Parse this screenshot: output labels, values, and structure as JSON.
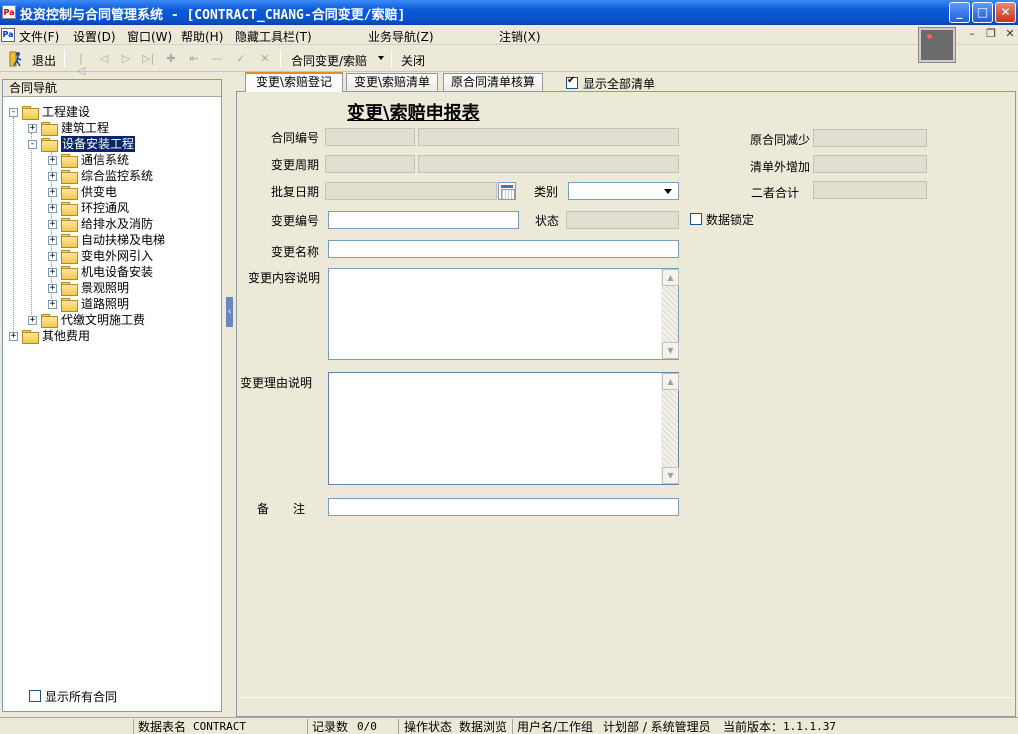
{
  "window": {
    "title": "投资控制与合同管理系统 - [CONTRACT_CHANG-合同变更/索赔]",
    "app_icon": "app-icon",
    "controls": {
      "minimize": "_",
      "maximize": "□",
      "close": "✕"
    }
  },
  "menubar": {
    "items": [
      "文件(F)",
      "设置(D)",
      "窗口(W)",
      "帮助(H)",
      "隐藏工具栏(T)",
      "业务导航(Z)",
      "注销(X)"
    ],
    "mdi_controls": [
      "–",
      "❐",
      "✕"
    ]
  },
  "toolbar": {
    "exit_label": "退出",
    "module_dropdown": "合同变更/索赔",
    "close_label": "关闭"
  },
  "nav": {
    "header": "合同导航",
    "tree": [
      {
        "label": "工程建设",
        "expander": "−",
        "level": 0
      },
      {
        "label": "建筑工程",
        "expander": "+",
        "level": 1
      },
      {
        "label": "设备安装工程",
        "expander": "−",
        "level": 1,
        "selected": true
      },
      {
        "label": "通信系统",
        "expander": "+",
        "level": 2
      },
      {
        "label": "综合监控系统",
        "expander": "+",
        "level": 2
      },
      {
        "label": "供变电",
        "expander": "+",
        "level": 2
      },
      {
        "label": "环控通风",
        "expander": "+",
        "level": 2
      },
      {
        "label": "给排水及消防",
        "expander": "+",
        "level": 2
      },
      {
        "label": "自动扶梯及电梯",
        "expander": "+",
        "level": 2
      },
      {
        "label": "变电外网引入",
        "expander": "+",
        "level": 2
      },
      {
        "label": "机电设备安装",
        "expander": "+",
        "level": 2
      },
      {
        "label": "景观照明",
        "expander": "+",
        "level": 2
      },
      {
        "label": "道路照明",
        "expander": "+",
        "level": 2
      },
      {
        "label": "代缴文明施工费",
        "expander": "+",
        "level": 1
      },
      {
        "label": "其他费用",
        "expander": "+",
        "level": 0
      }
    ],
    "show_all_contracts": "显示所有合同"
  },
  "tabs": {
    "items": [
      "变更\\索赔登记",
      "变更\\索赔清单",
      "原合同清单核算"
    ],
    "active_index": 0,
    "show_all_list_label": "显示全部清单",
    "show_all_list_checked": true
  },
  "form": {
    "title": "变更\\索赔申报表",
    "labels": {
      "contract_no": "合同编号",
      "change_period": "变更周期",
      "approve_date": "批复日期",
      "category": "类别",
      "change_no": "变更编号",
      "status": "状态",
      "data_lock": "数据锁定",
      "change_name": "变更名称",
      "content_desc": "变更内容说明",
      "reason_desc": "变更理由说明",
      "remark": "备　　注",
      "orig_decrease": "原合同减少",
      "extra_increase": "清单外增加",
      "total": "二者合计"
    },
    "values": {
      "contract_no_1": "",
      "contract_no_2": "",
      "change_period_1": "",
      "change_period_2": "",
      "approve_date": "",
      "category": "",
      "change_no": "",
      "status": "",
      "change_name": "",
      "content_desc": "",
      "reason_desc": "",
      "remark": "",
      "orig_decrease": "",
      "extra_increase": "",
      "total": ""
    },
    "data_lock_checked": false
  },
  "statusbar": {
    "table_label": "数据表名",
    "table_value": "CONTRACT",
    "record_label": "记录数",
    "record_value": "0/0",
    "op_label": "操作状态",
    "op_value": "数据浏览",
    "user_label": "用户名/工作组",
    "user_value": "计划部 / 系统管理员",
    "version_label": "当前版本：",
    "version_value": "1.1.1.37"
  }
}
